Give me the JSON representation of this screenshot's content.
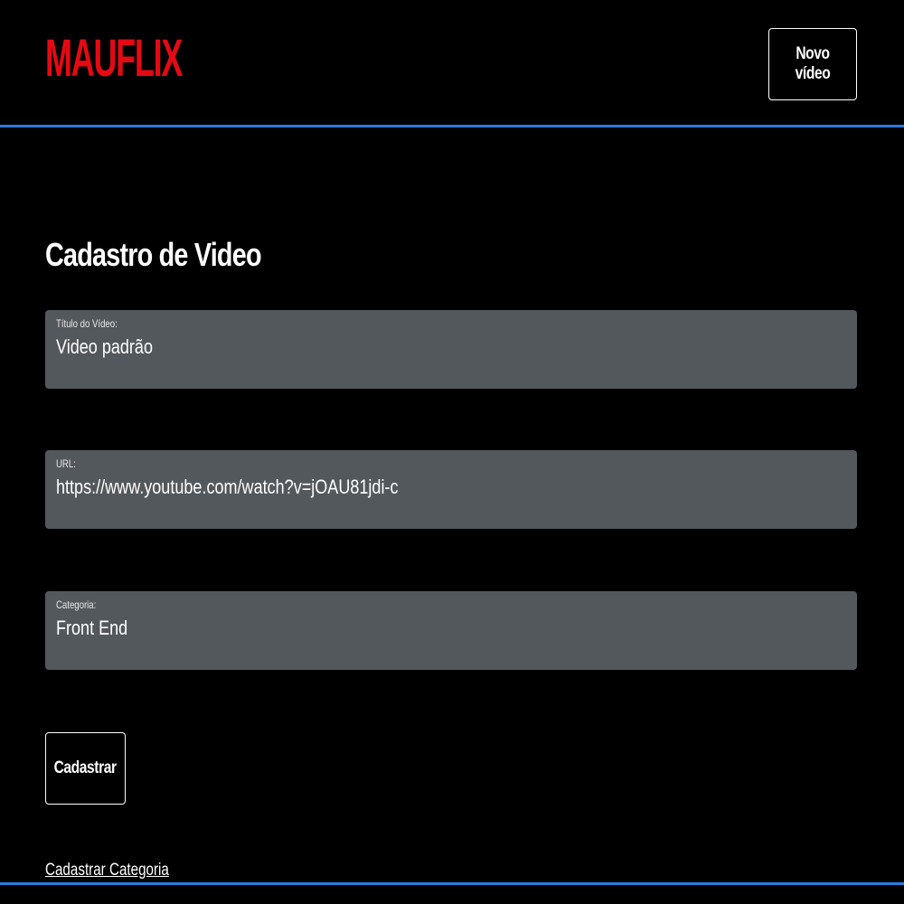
{
  "header": {
    "logo_text": "MAUFLIX",
    "new_video_label": "Novo vídeo"
  },
  "main": {
    "title": "Cadastro de Video",
    "fields": [
      {
        "label": "Título do Vídeo:",
        "value": "Video padrão"
      },
      {
        "label": "URL:",
        "value": "https://www.youtube.com/watch?v=jOAU81jdi-c"
      },
      {
        "label": "Categoria:",
        "value": "Front End"
      }
    ],
    "submit_label": "Cadastrar",
    "category_link": "Cadastrar Categoria"
  },
  "colors": {
    "background": "#000000",
    "brand": "#e50914",
    "accent": "#2a7ae4",
    "field_bg": "#53585d"
  }
}
